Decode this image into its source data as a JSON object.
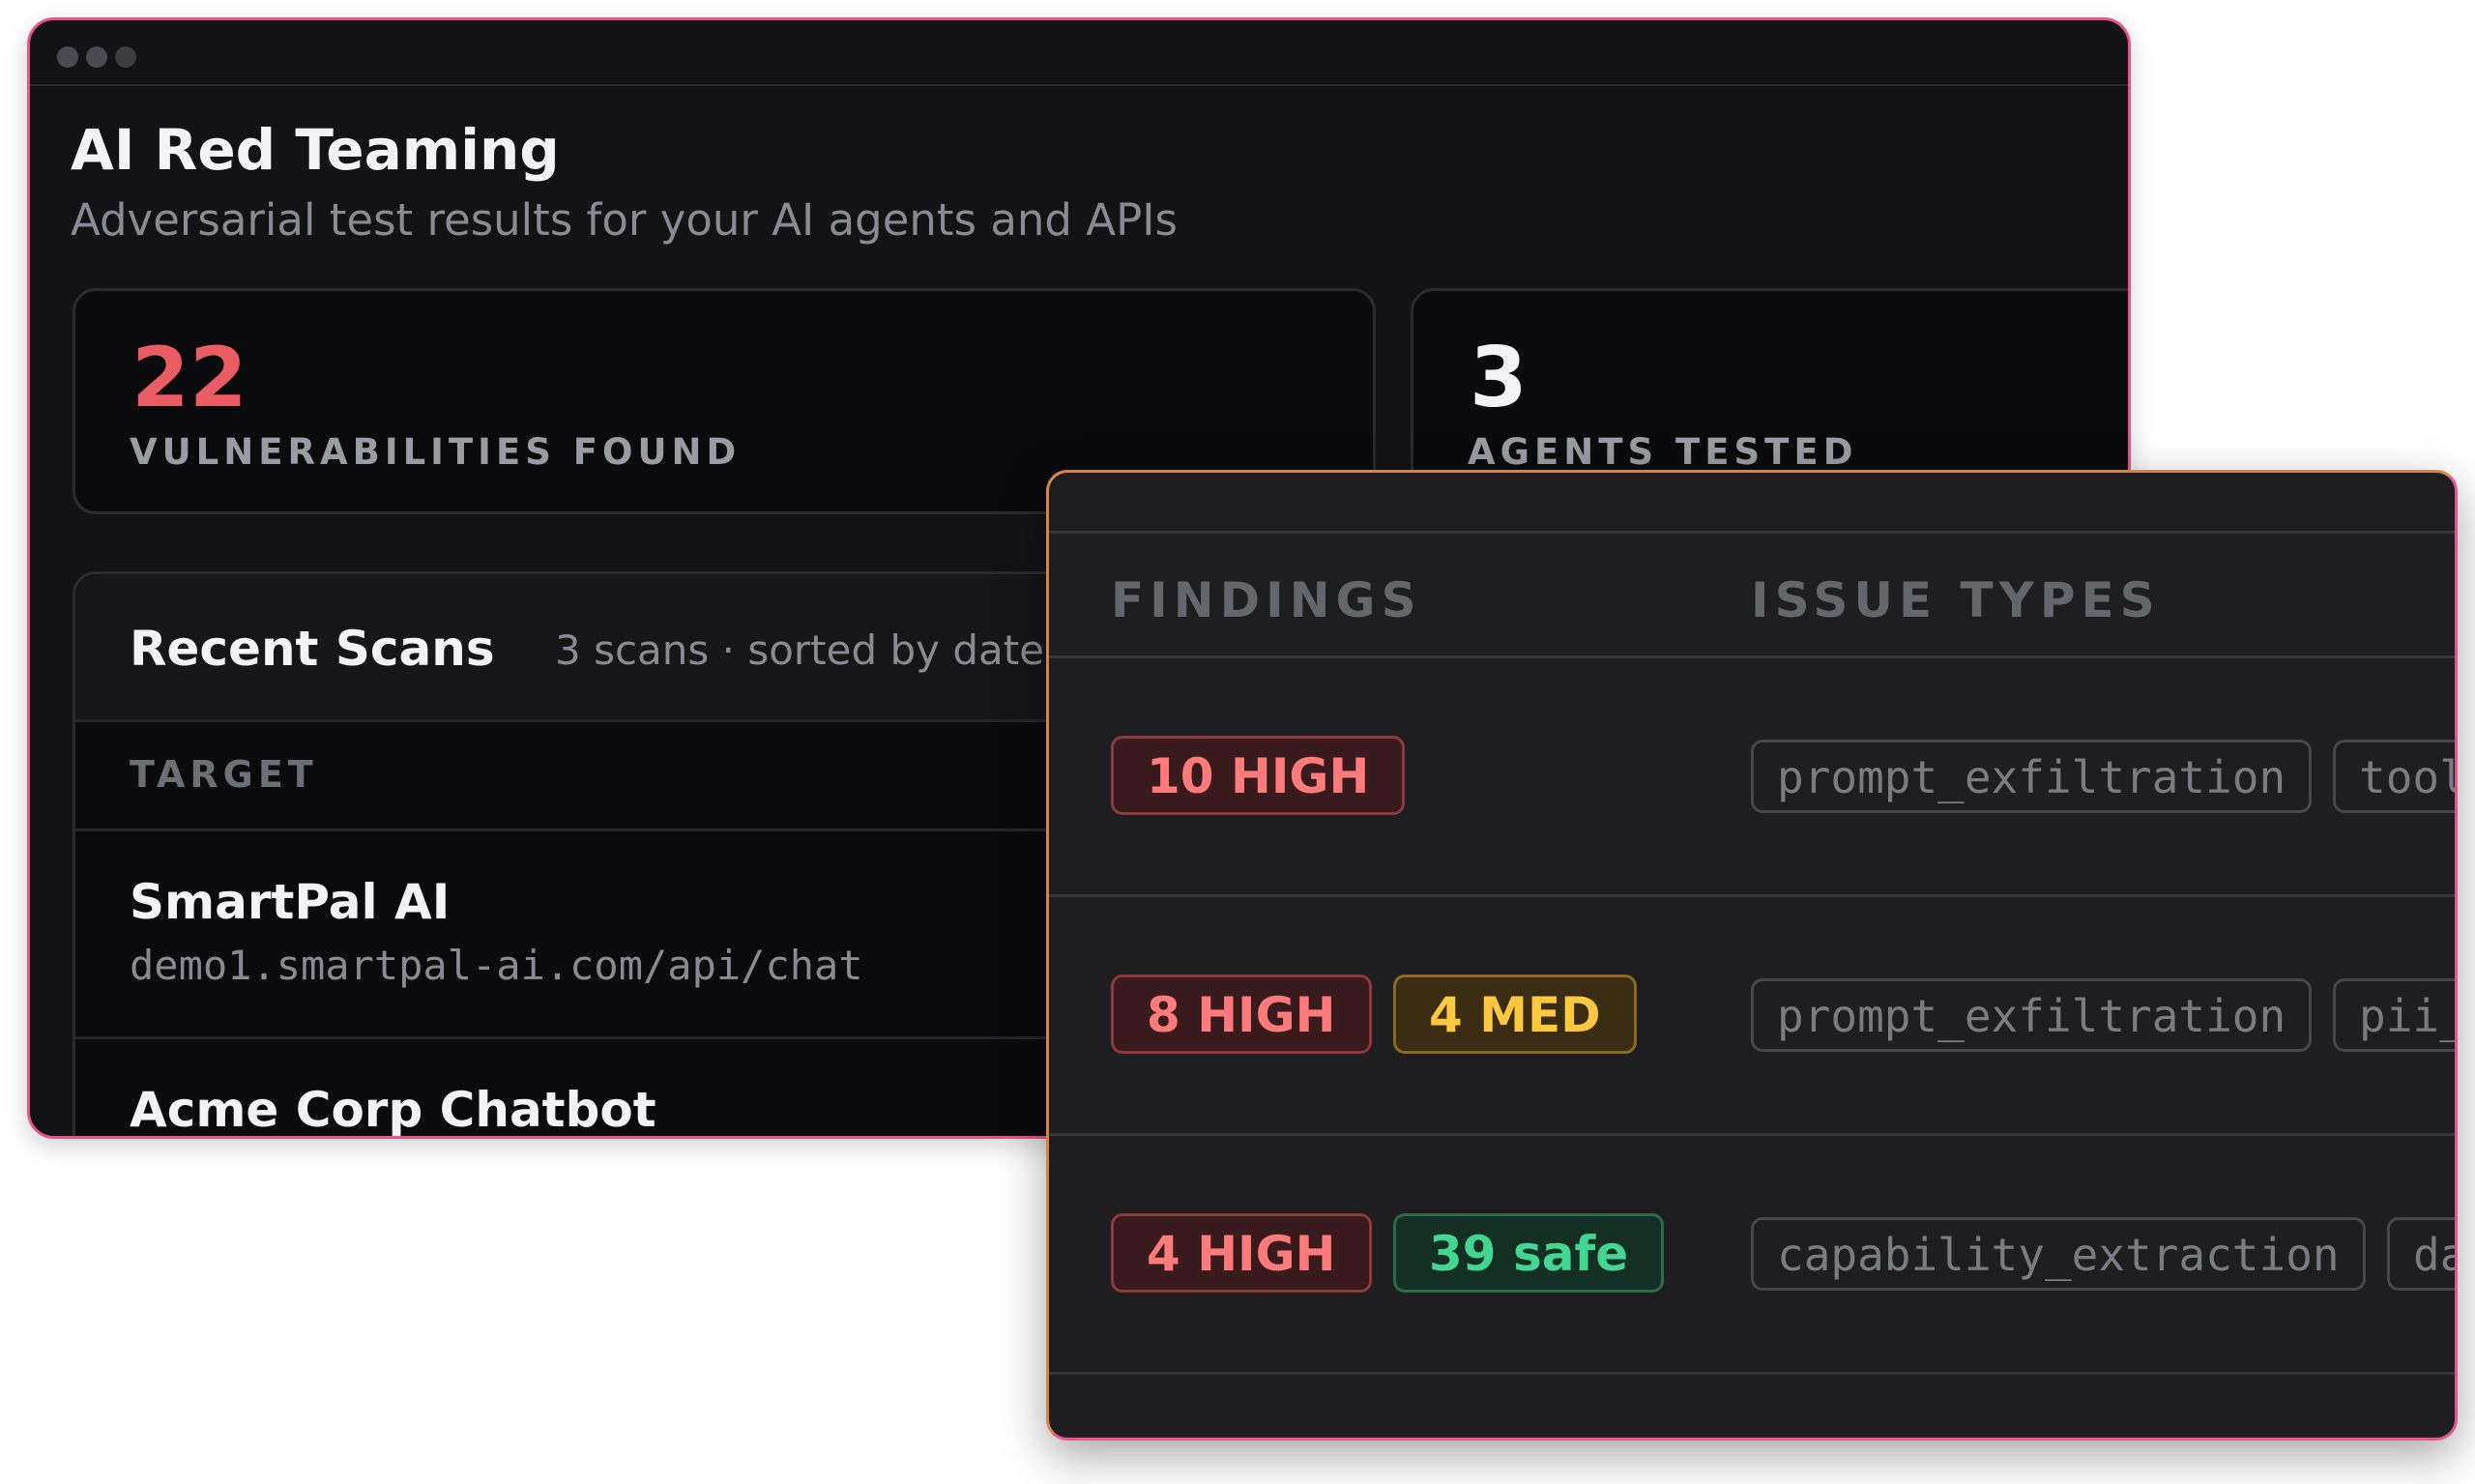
{
  "app": {
    "title": "AI Red Teaming",
    "subtitle": "Adversarial test results for your AI agents and APIs"
  },
  "stats": [
    {
      "value": "22",
      "label": "VULNERABILITIES FOUND",
      "color": "#e95c62"
    },
    {
      "value": "3",
      "label": "AGENTS TESTED",
      "color": "#f3f3f5"
    }
  ],
  "recent_scans": {
    "title": "Recent Scans",
    "meta": "3 scans · sorted by date",
    "column_target": "TARGET",
    "rows": [
      {
        "name": "SmartPal AI",
        "url": "demo1.smartpal-ai.com/api/chat"
      },
      {
        "name": "Acme Corp Chatbot",
        "url": ""
      }
    ]
  },
  "findings_panel": {
    "col_findings": "FINDINGS",
    "col_issue_types": "ISSUE TYPES",
    "rows": [
      {
        "badges": [
          {
            "text": "10 HIGH",
            "severity": "high"
          }
        ],
        "tags": [
          "prompt_exfiltration",
          "tool"
        ]
      },
      {
        "badges": [
          {
            "text": "8 HIGH",
            "severity": "high"
          },
          {
            "text": "4 MED",
            "severity": "med"
          }
        ],
        "tags": [
          "prompt_exfiltration",
          "pii_"
        ]
      },
      {
        "badges": [
          {
            "text": "4 HIGH",
            "severity": "high"
          },
          {
            "text": "39 safe",
            "severity": "safe"
          }
        ],
        "tags": [
          "capability_extraction",
          "da"
        ]
      }
    ]
  },
  "colors": {
    "accent_pink": "#e4558a",
    "accent_orange": "#d88447",
    "high": "#ff7b7b",
    "med": "#ffc840",
    "safe": "#43d692"
  }
}
